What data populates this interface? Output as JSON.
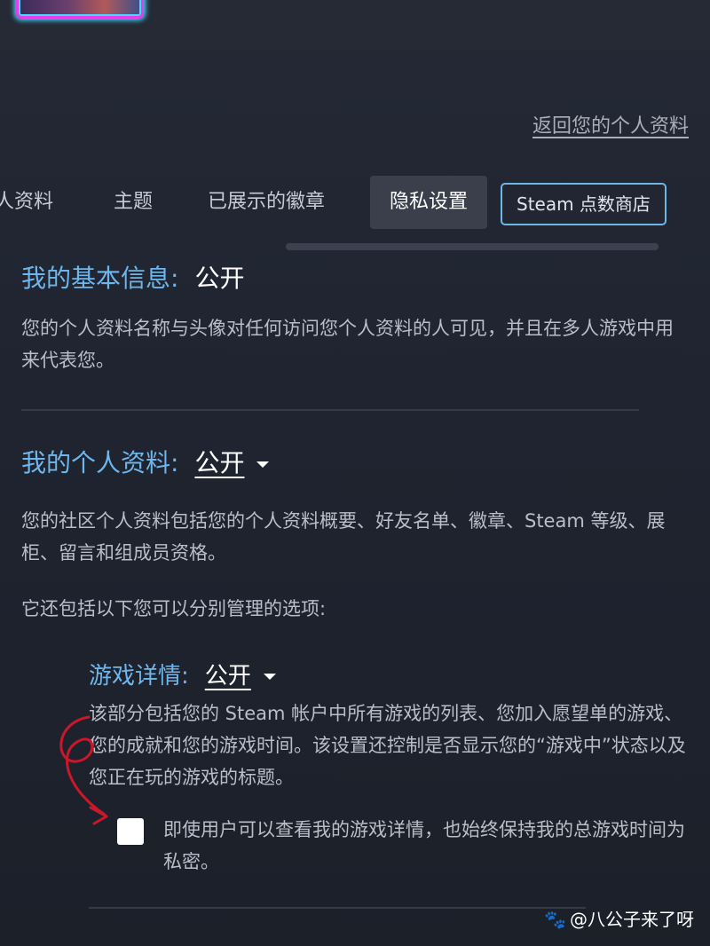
{
  "header": {
    "avatar_icon": "avatar-image"
  },
  "back_link": "返回您的个人资料",
  "tabs": [
    {
      "label": "人资料"
    },
    {
      "label": "主题"
    },
    {
      "label": "已展示的徽章"
    },
    {
      "label": "隐私设置"
    },
    {
      "label": "Steam 点数商店"
    }
  ],
  "basic_info": {
    "title": "我的基本信息:",
    "value": "公开",
    "description": "您的个人资料名称与头像对任何访问您个人资料的人可见，并且在多人游戏中用来代表您。"
  },
  "profile": {
    "title": "我的个人资料:",
    "value": "公开",
    "description": "您的社区个人资料包括您的个人资料概要、好友名单、徽章、Steam 等级、展柜、留言和组成员资格。",
    "note": "它还包括以下您可以分别管理的选项:"
  },
  "game_details": {
    "title": "游戏详情:",
    "value": "公开",
    "description": "该部分包括您的 Steam 帐户中所有游戏的列表、您加入愿望单的游戏、您的成就和您的游戏时间。该设置还控制是否显示您的“游戏中”状态以及您正在玩的游戏的标题。",
    "checkbox_label": "即使用户可以查看我的游戏详情，也始终保持我的总游戏时间为私密。",
    "checkbox_checked": false
  },
  "watermark": {
    "text": "@八公子来了呀",
    "icon": "paw-icon"
  },
  "colors": {
    "accent": "#6fb6ec",
    "background": "#1b1f29",
    "annotation": "#c8182a"
  }
}
